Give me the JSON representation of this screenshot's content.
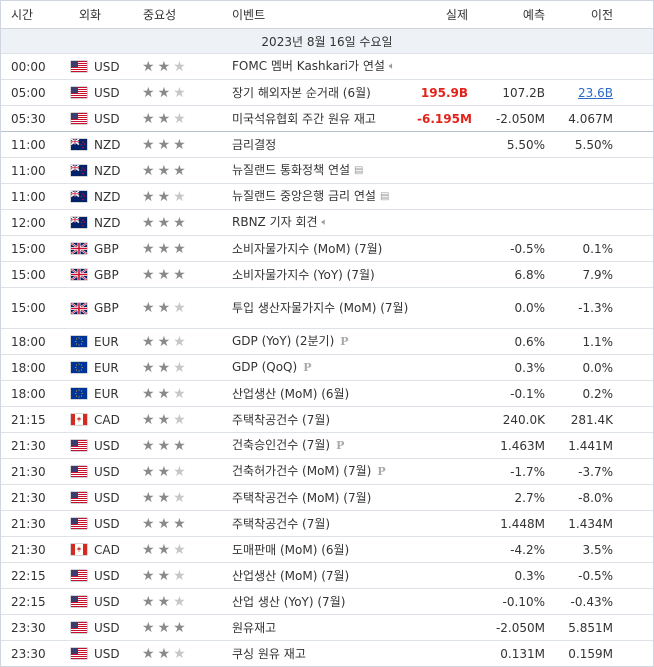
{
  "headers": {
    "time": "시간",
    "currency": "외화",
    "importance": "중요성",
    "event": "이벤트",
    "actual": "실제",
    "forecast": "예측",
    "previous": "이전"
  },
  "date_label": "2023년 8월 16일 수요일",
  "colors": {
    "red_value": "#e2231a",
    "link_value": "#2a6ac6",
    "star_on": "#8a8a8a",
    "star_off": "#c7c7c7"
  },
  "rows": [
    {
      "time": "00:00",
      "cur": "USD",
      "flag": "us",
      "stars": 2,
      "event": "FOMC 멤버 Kashkari가 연설",
      "icon": "speaker-icon",
      "actual": "",
      "forecast": "",
      "previous": ""
    },
    {
      "time": "05:00",
      "cur": "USD",
      "flag": "us",
      "stars": 2,
      "event": "장기 해외자본 순거래 (6월)",
      "icon": "",
      "actual": "195.9B",
      "actual_style": "red",
      "forecast": "107.2B",
      "previous": "23.6B",
      "previous_style": "link"
    },
    {
      "time": "05:30",
      "cur": "USD",
      "flag": "us",
      "stars": 2,
      "event": "미국석유협회 주간 원유 재고",
      "icon": "",
      "actual": "-6.195M",
      "actual_style": "red",
      "forecast": "-2.050M",
      "previous": "4.067M",
      "sep": true
    },
    {
      "time": "11:00",
      "cur": "NZD",
      "flag": "nz",
      "stars": 3,
      "event": "금리결정",
      "icon": "",
      "actual": "",
      "forecast": "5.50%",
      "previous": "5.50%"
    },
    {
      "time": "11:00",
      "cur": "NZD",
      "flag": "nz",
      "stars": 3,
      "event": "뉴질랜드 통화정책 연설",
      "icon": "document-icon",
      "actual": "",
      "forecast": "",
      "previous": ""
    },
    {
      "time": "11:00",
      "cur": "NZD",
      "flag": "nz",
      "stars": 2,
      "event": "뉴질랜드 중앙은행 금리 연설",
      "icon": "document-icon",
      "actual": "",
      "forecast": "",
      "previous": ""
    },
    {
      "time": "12:00",
      "cur": "NZD",
      "flag": "nz",
      "stars": 3,
      "event": "RBNZ 기자 회견",
      "icon": "speaker-icon",
      "actual": "",
      "forecast": "",
      "previous": ""
    },
    {
      "time": "15:00",
      "cur": "GBP",
      "flag": "gb",
      "stars": 3,
      "event": "소비자물가지수 (MoM) (7월)",
      "icon": "",
      "actual": "",
      "forecast": "-0.5%",
      "previous": "0.1%"
    },
    {
      "time": "15:00",
      "cur": "GBP",
      "flag": "gb",
      "stars": 3,
      "event": "소비자물가지수 (YoY) (7월)",
      "icon": "",
      "actual": "",
      "forecast": "6.8%",
      "previous": "7.9%"
    },
    {
      "time": "15:00",
      "cur": "GBP",
      "flag": "gb",
      "stars": 2,
      "event": "투입 생산자물가지수 (MoM) (7월)",
      "icon": "",
      "actual": "",
      "forecast": "0.0%",
      "previous": "-1.3%",
      "tall": true
    },
    {
      "time": "18:00",
      "cur": "EUR",
      "flag": "eu",
      "stars": 2,
      "event": "GDP (YoY) (2분기)",
      "icon": "p-icon",
      "actual": "",
      "forecast": "0.6%",
      "previous": "1.1%"
    },
    {
      "time": "18:00",
      "cur": "EUR",
      "flag": "eu",
      "stars": 2,
      "event": "GDP (QoQ)",
      "icon": "p-icon",
      "actual": "",
      "forecast": "0.3%",
      "previous": "0.0%"
    },
    {
      "time": "18:00",
      "cur": "EUR",
      "flag": "eu",
      "stars": 2,
      "event": "산업생산 (MoM) (6월)",
      "icon": "",
      "actual": "",
      "forecast": "-0.1%",
      "previous": "0.2%"
    },
    {
      "time": "21:15",
      "cur": "CAD",
      "flag": "ca",
      "stars": 2,
      "event": "주택착공건수 (7월)",
      "icon": "",
      "actual": "",
      "forecast": "240.0K",
      "previous": "281.4K"
    },
    {
      "time": "21:30",
      "cur": "USD",
      "flag": "us",
      "stars": 3,
      "event": "건축승인건수 (7월)",
      "icon": "p-icon",
      "actual": "",
      "forecast": "1.463M",
      "previous": "1.441M"
    },
    {
      "time": "21:30",
      "cur": "USD",
      "flag": "us",
      "stars": 2,
      "event": "건축허가건수 (MoM) (7월)",
      "icon": "p-icon",
      "actual": "",
      "forecast": "-1.7%",
      "previous": "-3.7%"
    },
    {
      "time": "21:30",
      "cur": "USD",
      "flag": "us",
      "stars": 2,
      "event": "주택착공건수 (MoM) (7월)",
      "icon": "",
      "actual": "",
      "forecast": "2.7%",
      "previous": "-8.0%"
    },
    {
      "time": "21:30",
      "cur": "USD",
      "flag": "us",
      "stars": 3,
      "event": "주택착공건수 (7월)",
      "icon": "",
      "actual": "",
      "forecast": "1.448M",
      "previous": "1.434M"
    },
    {
      "time": "21:30",
      "cur": "CAD",
      "flag": "ca",
      "stars": 2,
      "event": "도매판매 (MoM) (6월)",
      "icon": "",
      "actual": "",
      "forecast": "-4.2%",
      "previous": "3.5%"
    },
    {
      "time": "22:15",
      "cur": "USD",
      "flag": "us",
      "stars": 2,
      "event": "산업생산 (MoM) (7월)",
      "icon": "",
      "actual": "",
      "forecast": "0.3%",
      "previous": "-0.5%"
    },
    {
      "time": "22:15",
      "cur": "USD",
      "flag": "us",
      "stars": 2,
      "event": "산업 생산 (YoY) (7월)",
      "icon": "",
      "actual": "",
      "forecast": "-0.10%",
      "previous": "-0.43%"
    },
    {
      "time": "23:30",
      "cur": "USD",
      "flag": "us",
      "stars": 3,
      "event": "원유재고",
      "icon": "",
      "actual": "",
      "forecast": "-2.050M",
      "previous": "5.851M"
    },
    {
      "time": "23:30",
      "cur": "USD",
      "flag": "us",
      "stars": 2,
      "event": "쿠싱 원유 재고",
      "icon": "",
      "actual": "",
      "forecast": "0.131M",
      "previous": "0.159M"
    }
  ]
}
